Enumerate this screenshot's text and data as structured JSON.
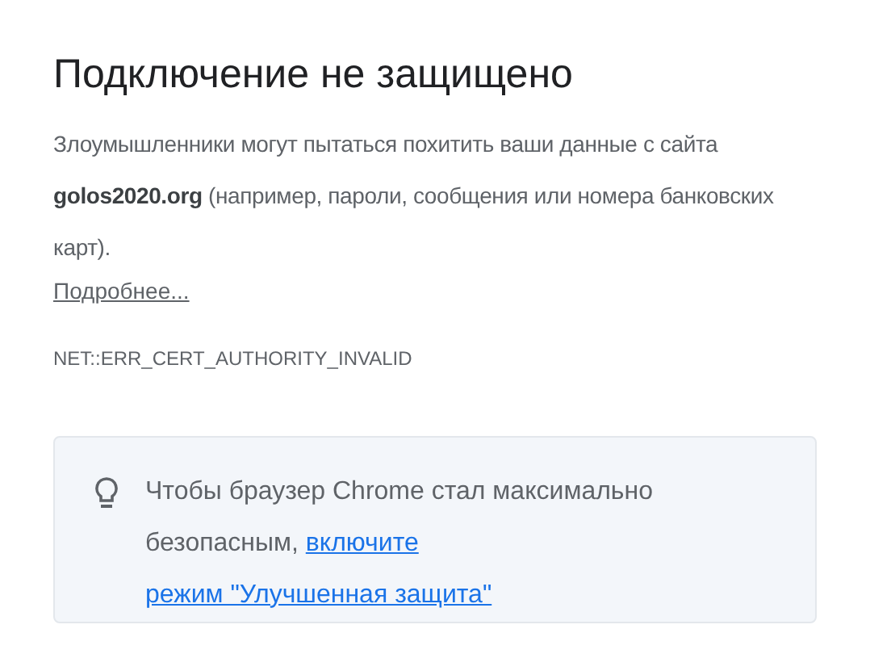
{
  "title": "Подключение не защищено",
  "message": "Злоумышленники могут пытаться похитить ваши данные с сайта **golos2020.org** (например, пароли, сообщения или номера банковских карт).",
  "more_link": "Подробнее...",
  "error_code": "NET::ERR_CERT_AUTHORITY_INVALID",
  "tip": {
    "text": "Чтобы браузер Chrome стал максимально безопасным,",
    "link_parts": [
      "включите",
      "режим \"Улучшенная защита\""
    ]
  }
}
